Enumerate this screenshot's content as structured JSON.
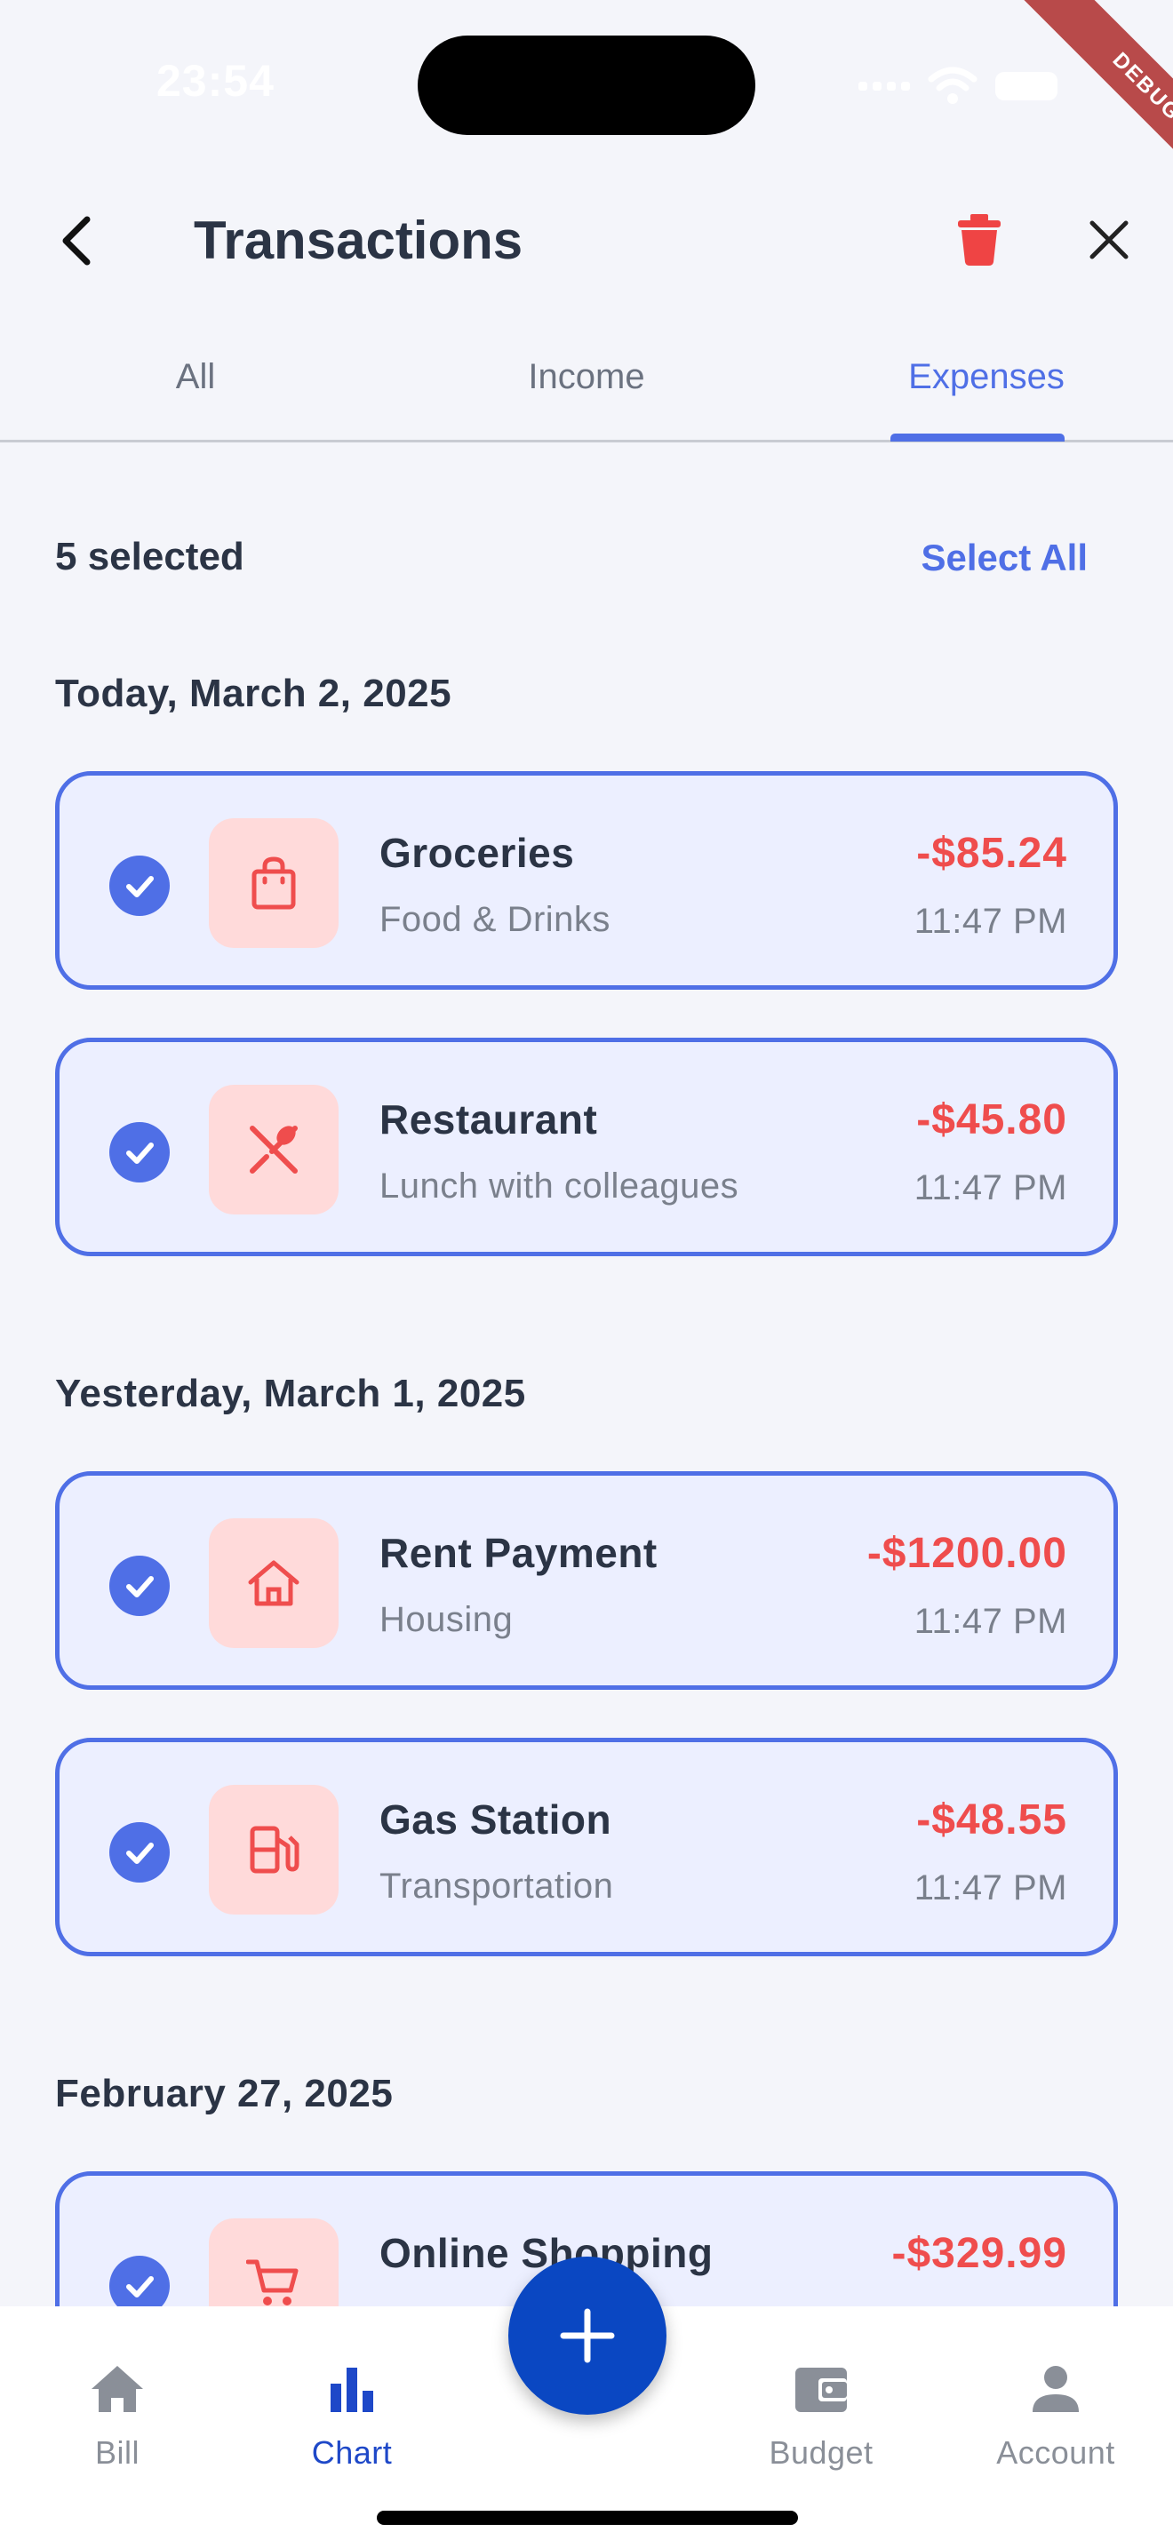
{
  "status_bar": {
    "time": "23:54"
  },
  "debug_banner": "DEBUG",
  "header": {
    "title": "Transactions"
  },
  "tabs": [
    {
      "label": "All"
    },
    {
      "label": "Income"
    },
    {
      "label": "Expenses"
    }
  ],
  "active_tab": "Expenses",
  "selection": {
    "count_label": "5 selected",
    "select_all_label": "Select All"
  },
  "sections": [
    {
      "date": "Today, March 2, 2025",
      "transactions": [
        {
          "name": "Groceries",
          "category": "Food & Drinks",
          "amount": "-$85.24",
          "time": "11:47 PM",
          "icon": "shopping-bag-icon",
          "selected": true
        },
        {
          "name": "Restaurant",
          "category": "Lunch with colleagues",
          "amount": "-$45.80",
          "time": "11:47 PM",
          "icon": "utensils-icon",
          "selected": true
        }
      ]
    },
    {
      "date": "Yesterday, March 1, 2025",
      "transactions": [
        {
          "name": "Rent Payment",
          "category": "Housing",
          "amount": "-$1200.00",
          "time": "11:47 PM",
          "icon": "house-icon",
          "selected": true
        },
        {
          "name": "Gas Station",
          "category": "Transportation",
          "amount": "-$48.55",
          "time": "11:47 PM",
          "icon": "fuel-pump-icon",
          "selected": true
        }
      ]
    },
    {
      "date": "February 27, 2025",
      "transactions": [
        {
          "name": "Online Shopping",
          "category": "",
          "amount": "-$329.99",
          "time": "",
          "icon": "shopping-cart-icon",
          "selected": true
        }
      ]
    }
  ],
  "bottom_nav": [
    {
      "label": "Bill",
      "icon": "home-icon"
    },
    {
      "label": "Chart",
      "icon": "bar-chart-icon"
    },
    {
      "label": "Budget",
      "icon": "wallet-icon"
    },
    {
      "label": "Account",
      "icon": "person-icon"
    }
  ],
  "active_nav": "Chart",
  "colors": {
    "accent": "#4f6fe6",
    "expense": "#ef4d4d",
    "card_bg": "#ecefff",
    "icon_tile_bg": "#ffdada",
    "fab": "#0a47c2",
    "nav_active": "#1e48c8"
  }
}
